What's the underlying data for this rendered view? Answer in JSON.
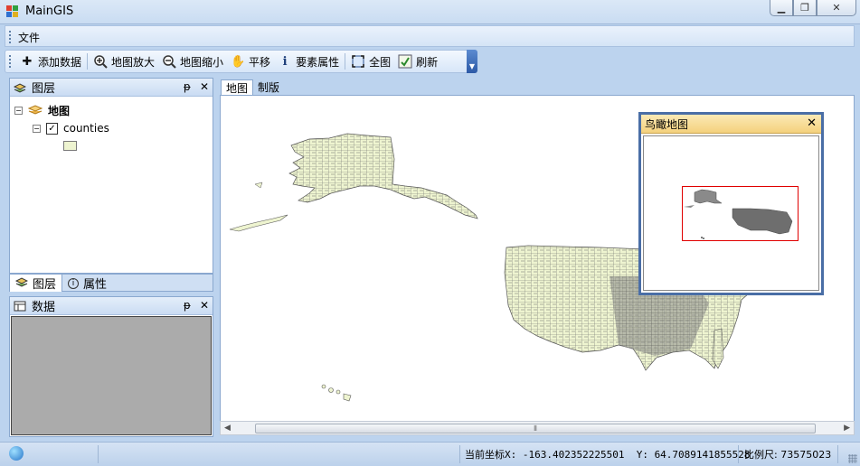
{
  "window": {
    "title": "MainGIS"
  },
  "menu": {
    "items": [
      {
        "label": "文件"
      }
    ]
  },
  "toolbar": {
    "buttons": [
      {
        "label": "添加数据",
        "icon": "plus-icon"
      },
      {
        "label": "地图放大",
        "icon": "zoom-in-icon"
      },
      {
        "label": "地图缩小",
        "icon": "zoom-out-icon"
      },
      {
        "label": "平移",
        "icon": "pan-hand-icon"
      },
      {
        "label": "要素属性",
        "icon": "info-icon"
      },
      {
        "label": "全图",
        "icon": "full-extent-icon"
      },
      {
        "label": "刷新",
        "icon": "refresh-icon"
      }
    ]
  },
  "layers_panel": {
    "title": "图层",
    "root_label": "地图",
    "layer_label": "counties",
    "layer_checked": true,
    "tabs": [
      {
        "label": "图层"
      },
      {
        "label": "属性"
      }
    ]
  },
  "data_panel": {
    "title": "数据"
  },
  "map_view": {
    "tabs": [
      {
        "label": "地图"
      },
      {
        "label": "制版"
      }
    ],
    "fill_color": "#eef4d0"
  },
  "overview": {
    "title": "鸟瞰地图",
    "extent_color": "#e00000"
  },
  "status": {
    "coords_label": "当前坐标X: -163.402352225501  Y: 64.7089141855528",
    "scale_label": "比例尺: 73575023"
  }
}
